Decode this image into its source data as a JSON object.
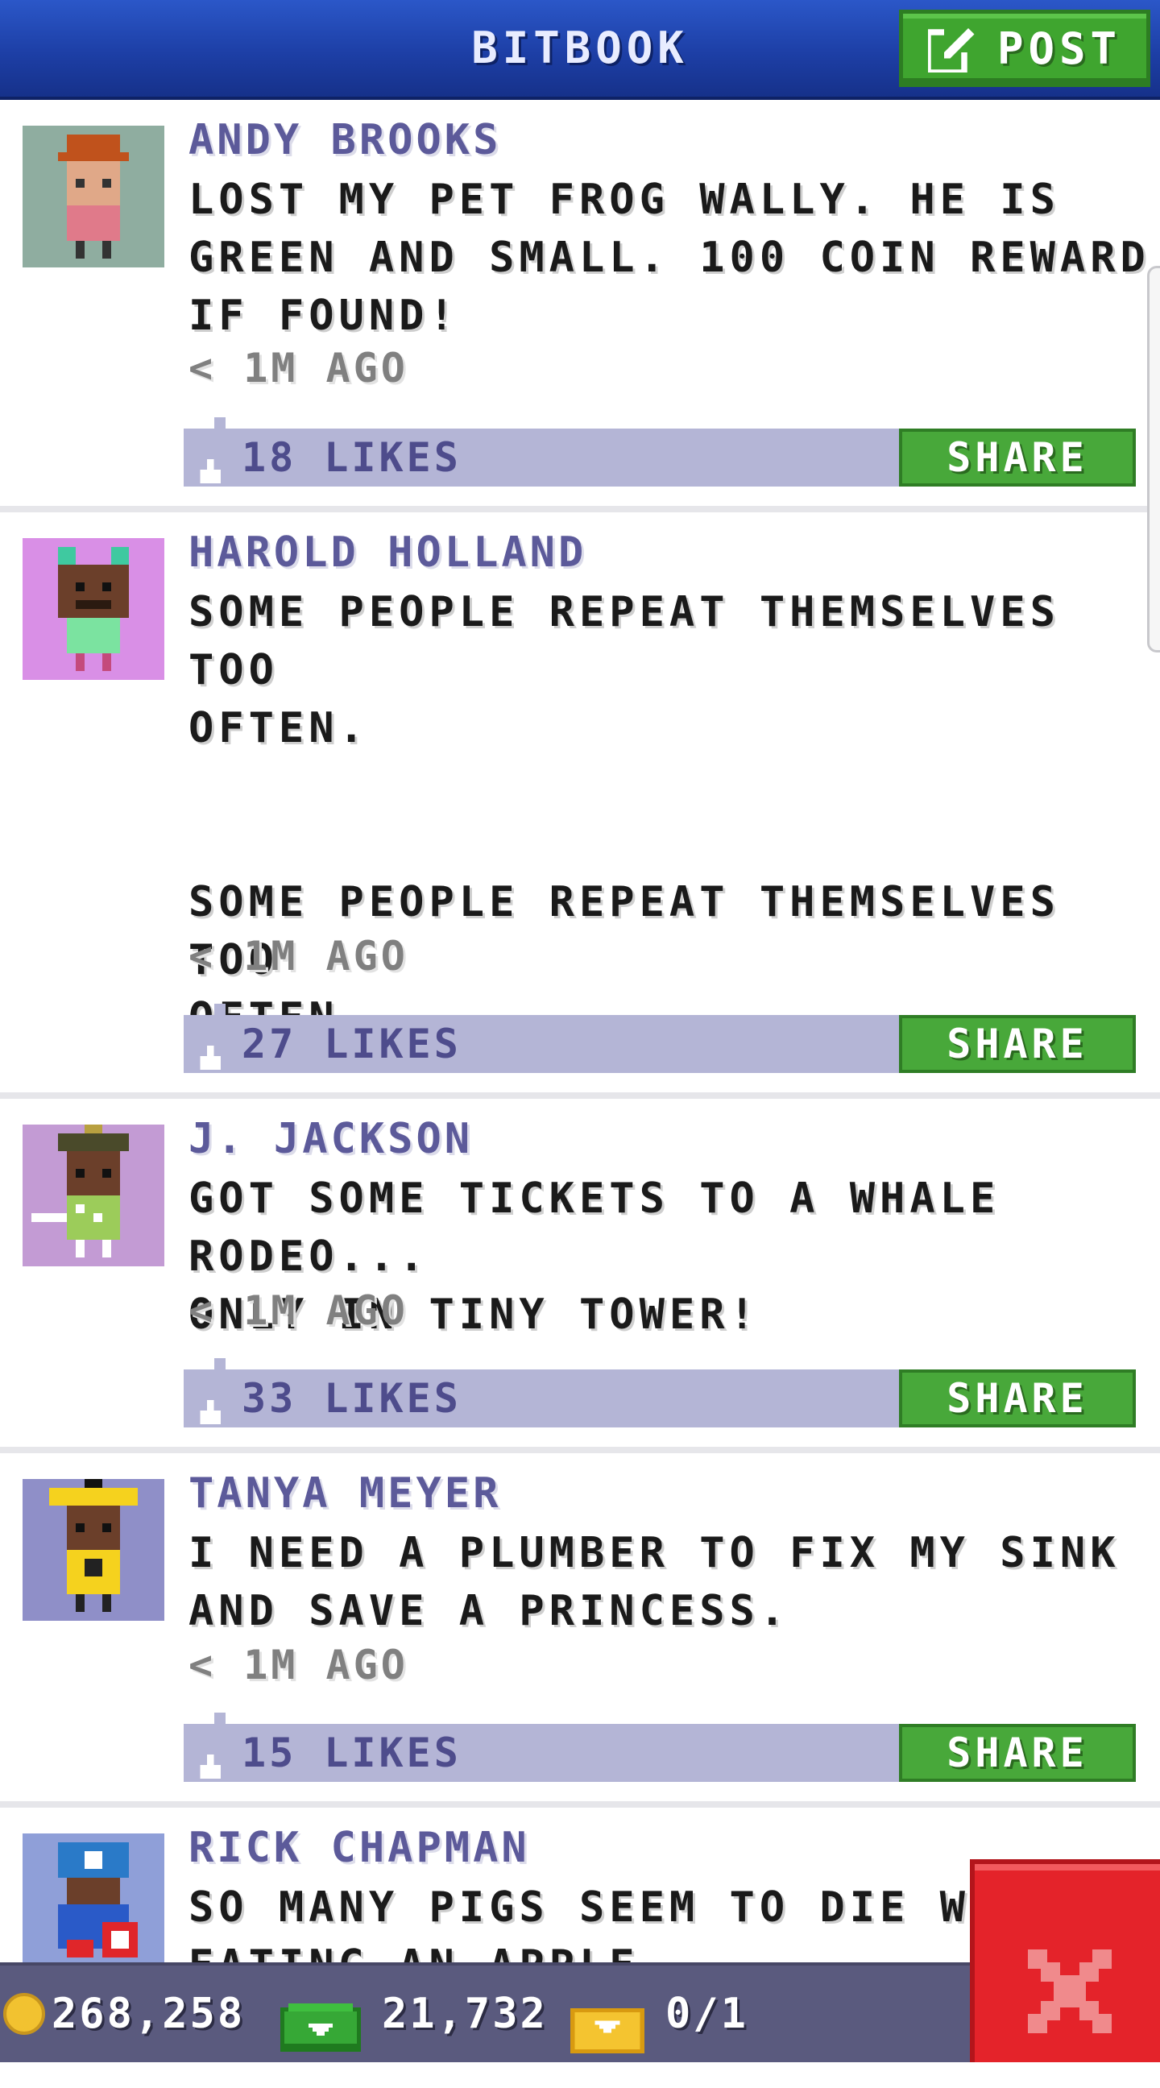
{
  "header": {
    "title": "BITBOOK",
    "post_label": "POST"
  },
  "posts": [
    {
      "author": "ANDY BROOKS",
      "message": "LOST MY PET FROG WALLY. HE IS\nGREEN AND SMALL. 100 COIN REWARD\nIF FOUND!",
      "time": "< 1M AGO",
      "likes": "18 LIKES",
      "share_label": "SHARE",
      "avatar_bg": "#8fada0"
    },
    {
      "author": "HAROLD HOLLAND",
      "message": "SOME PEOPLE REPEAT THEMSELVES TOO\nOFTEN.\n\n\nSOME PEOPLE REPEAT THEMSELVES TOO\nOFTEN.",
      "time": "< 1M AGO",
      "likes": "27 LIKES",
      "share_label": "SHARE",
      "avatar_bg": "#d98fe6"
    },
    {
      "author": "J. JACKSON",
      "message": "GOT SOME TICKETS TO A WHALE RODEO...\nONLY IN TINY TOWER!",
      "time": "< 1M AGO",
      "likes": "33 LIKES",
      "share_label": "SHARE",
      "avatar_bg": "#c39bd4"
    },
    {
      "author": "TANYA MEYER",
      "message": "I NEED A PLUMBER TO FIX MY SINK\nAND SAVE A PRINCESS.",
      "time": "< 1M AGO",
      "likes": "15 LIKES",
      "share_label": "SHARE",
      "avatar_bg": "#8f8fc8"
    },
    {
      "author": "RICK CHAPMAN",
      "message": "SO MANY PIGS SEEM TO DIE WHIL\nEATING AN APPLE",
      "avatar_bg": "#8f9fd8"
    }
  ],
  "bottom_bar": {
    "coins": "268,258",
    "bux": "21,732",
    "tickets": "0/1"
  },
  "colors": {
    "header": "#1d3fa6",
    "accent_green": "#48a83a",
    "like_bar": "#b4b5d6",
    "close_red": "#e4232a"
  },
  "icons": [
    "edit-icon",
    "thumbs-up-icon",
    "coin-icon",
    "bux-icon",
    "ticket-icon",
    "close-icon"
  ]
}
